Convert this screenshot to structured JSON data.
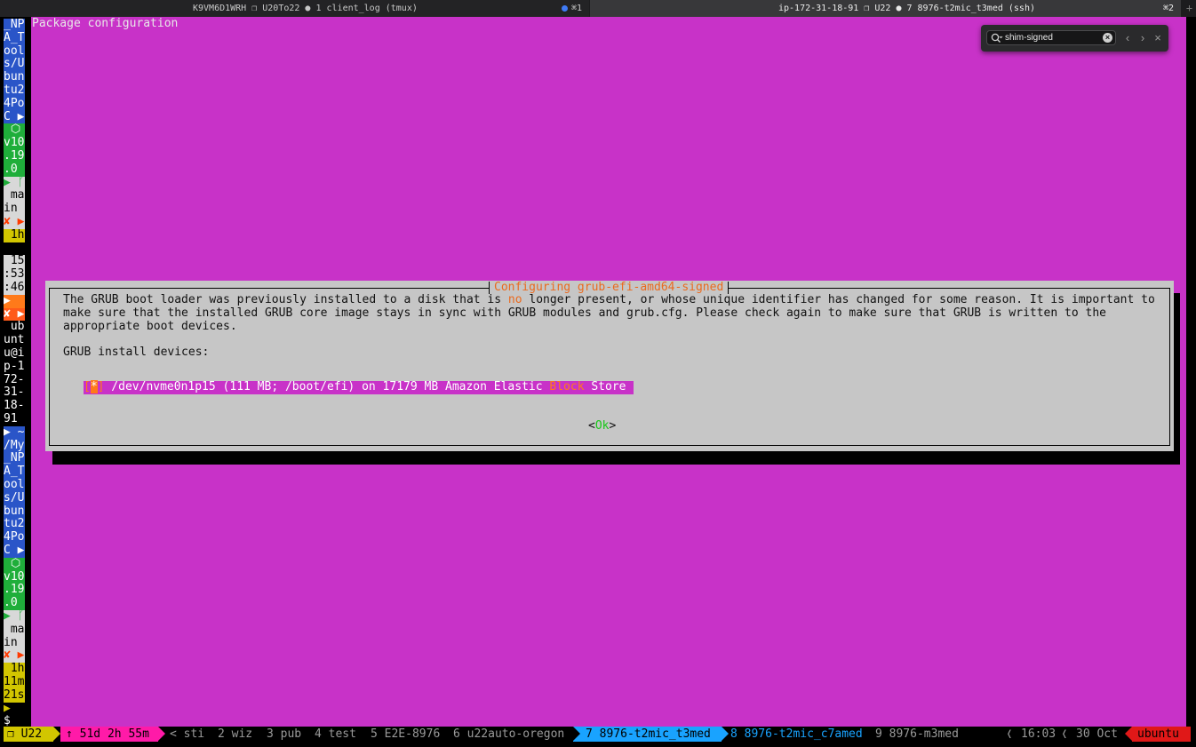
{
  "tabs": [
    {
      "title": "K9VM6D1WRH ❐ U20To22 ● 1 client_log (tmux)",
      "shortcut": "⌘1",
      "active": false,
      "has_activity": true
    },
    {
      "title": "ip-172-31-18-91 ❐ U22 ● 7 8976-t2mic_t3med (ssh)",
      "shortcut": "⌘2",
      "active": true
    }
  ],
  "new_tab": "+",
  "left_pane_lines": [
    {
      "text": "_NP",
      "fg": "#ffffff",
      "bg": "#2a55c8"
    },
    {
      "text": "A_T",
      "fg": "#ffffff",
      "bg": "#2a55c8"
    },
    {
      "text": "ool",
      "fg": "#ffffff",
      "bg": "#2a55c8"
    },
    {
      "text": "s/U",
      "fg": "#ffffff",
      "bg": "#2a55c8"
    },
    {
      "text": "bun",
      "fg": "#ffffff",
      "bg": "#2a55c8"
    },
    {
      "text": "tu2",
      "fg": "#ffffff",
      "bg": "#2a55c8"
    },
    {
      "text": "4Po",
      "fg": "#ffffff",
      "bg": "#2a55c8"
    },
    {
      "text": "C ▶",
      "fg": "#ffffff",
      "bg": "#2a55c8"
    },
    {
      "text": " ⬡",
      "fg": "#ffffff",
      "bg": "#1fae3a"
    },
    {
      "text": "v10",
      "fg": "#ffffff",
      "bg": "#1fae3a"
    },
    {
      "text": ".19",
      "fg": "#ffffff",
      "bg": "#1fae3a"
    },
    {
      "text": ".0",
      "fg": "#ffffff",
      "bg": "#1fae3a"
    },
    {
      "text": "▶ ᚴ",
      "fg": "#1fae3a",
      "bg": "#d8d8d8"
    },
    {
      "text": " ma",
      "fg": "#000000",
      "bg": "#d8d8d8"
    },
    {
      "text": "in",
      "fg": "#000000",
      "bg": "#d8d8d8"
    },
    {
      "text": "✘ ▶",
      "fg": "#ff3a00",
      "bg": "#d8d8d8"
    },
    {
      "text": " 1h",
      "fg": "#000000",
      "bg": "#d2c600"
    },
    {
      "text": "",
      "fg": "#000000",
      "bg": "#000000"
    },
    {
      "text": " 15",
      "fg": "#000000",
      "bg": "#d8d8d8"
    },
    {
      "text": ":53",
      "fg": "#000000",
      "bg": "#d8d8d8"
    },
    {
      "text": ":46",
      "fg": "#000000",
      "bg": "#d8d8d8"
    },
    {
      "text": "▶",
      "fg": "#ffffff",
      "bg": "#ff7a1a"
    },
    {
      "text": "✘ ▶",
      "fg": "#ffffff",
      "bg": "#ff5a1a"
    },
    {
      "text": " ub",
      "fg": "#ffffff",
      "bg": "#000000"
    },
    {
      "text": "unt",
      "fg": "#ffffff",
      "bg": "#000000"
    },
    {
      "text": "u@i",
      "fg": "#ffffff",
      "bg": "#000000"
    },
    {
      "text": "p-1",
      "fg": "#ffffff",
      "bg": "#000000"
    },
    {
      "text": "72-",
      "fg": "#ffffff",
      "bg": "#000000"
    },
    {
      "text": "31-",
      "fg": "#ffffff",
      "bg": "#000000"
    },
    {
      "text": "18-",
      "fg": "#ffffff",
      "bg": "#000000"
    },
    {
      "text": "91",
      "fg": "#ffffff",
      "bg": "#000000"
    },
    {
      "text": "▶ ~",
      "fg": "#ffffff",
      "bg": "#2a55c8"
    },
    {
      "text": "/My",
      "fg": "#ffffff",
      "bg": "#2a55c8"
    },
    {
      "text": "_NP",
      "fg": "#ffffff",
      "bg": "#2a55c8"
    },
    {
      "text": "A_T",
      "fg": "#ffffff",
      "bg": "#2a55c8"
    },
    {
      "text": "ool",
      "fg": "#ffffff",
      "bg": "#2a55c8"
    },
    {
      "text": "s/U",
      "fg": "#ffffff",
      "bg": "#2a55c8"
    },
    {
      "text": "bun",
      "fg": "#ffffff",
      "bg": "#2a55c8"
    },
    {
      "text": "tu2",
      "fg": "#ffffff",
      "bg": "#2a55c8"
    },
    {
      "text": "4Po",
      "fg": "#ffffff",
      "bg": "#2a55c8"
    },
    {
      "text": "C ▶",
      "fg": "#ffffff",
      "bg": "#2a55c8"
    },
    {
      "text": " ⬡",
      "fg": "#ffffff",
      "bg": "#1fae3a"
    },
    {
      "text": "v10",
      "fg": "#ffffff",
      "bg": "#1fae3a"
    },
    {
      "text": ".19",
      "fg": "#ffffff",
      "bg": "#1fae3a"
    },
    {
      "text": ".0",
      "fg": "#ffffff",
      "bg": "#1fae3a"
    },
    {
      "text": "▶ ᚴ",
      "fg": "#1fae3a",
      "bg": "#d8d8d8"
    },
    {
      "text": " ma",
      "fg": "#000000",
      "bg": "#d8d8d8"
    },
    {
      "text": "in",
      "fg": "#000000",
      "bg": "#d8d8d8"
    },
    {
      "text": "✘ ▶",
      "fg": "#ff3a00",
      "bg": "#d8d8d8"
    },
    {
      "text": " 1h",
      "fg": "#000000",
      "bg": "#d2c600"
    },
    {
      "text": "11m",
      "fg": "#000000",
      "bg": "#d2c600"
    },
    {
      "text": "21s",
      "fg": "#000000",
      "bg": "#d2c600"
    },
    {
      "text": "▶",
      "fg": "#d2c600",
      "bg": "#000000"
    },
    {
      "text": "$",
      "fg": "#ffffff",
      "bg": "#000000"
    }
  ],
  "terminal": {
    "header": "Package configuration",
    "bg_color": "#c832c8"
  },
  "dialog": {
    "title": "Configuring grub-efi-amd64-signed",
    "line1_a": "The GRUB boot loader was previously installed to a disk that is ",
    "line1_no": "no",
    "line1_b": " longer present, or whose unique identifier has changed for some reason. It is important to",
    "line2": "make sure that the installed GRUB core image stays in sync with GRUB modules and grub.cfg. Please check again to make sure that GRUB is written to the",
    "line3": "appropriate boot devices.",
    "prompt": "GRUB install devices:",
    "device_open": "[",
    "device_check": "*",
    "device_close": "]",
    "device_a": " /dev/nvme0n1p15 (111 MB; /boot/efi) on 17179 MB Amazon Elastic ",
    "device_block": "Block",
    "device_b": " Store",
    "ok_lt": "<",
    "ok_label": "Ok",
    "ok_gt": ">"
  },
  "findbar": {
    "query": "shim-signed",
    "prev": "‹",
    "next": "›",
    "close": "×"
  },
  "statusbar": {
    "session": "❐ U22",
    "uptime": "↑ 51d 2h 55m",
    "windows": [
      "< sti",
      "2 wiz",
      "3 pub",
      "4 test",
      "5 E2E-8976",
      "6 u22auto-oregon"
    ],
    "active_window": "7 8976-t2mic_t3med",
    "windows_after": [
      "8 8976-t2mic_c7amed",
      "9 8976-m3med"
    ],
    "time": "16:03",
    "date": "30 Oct",
    "host": "ubuntu"
  }
}
